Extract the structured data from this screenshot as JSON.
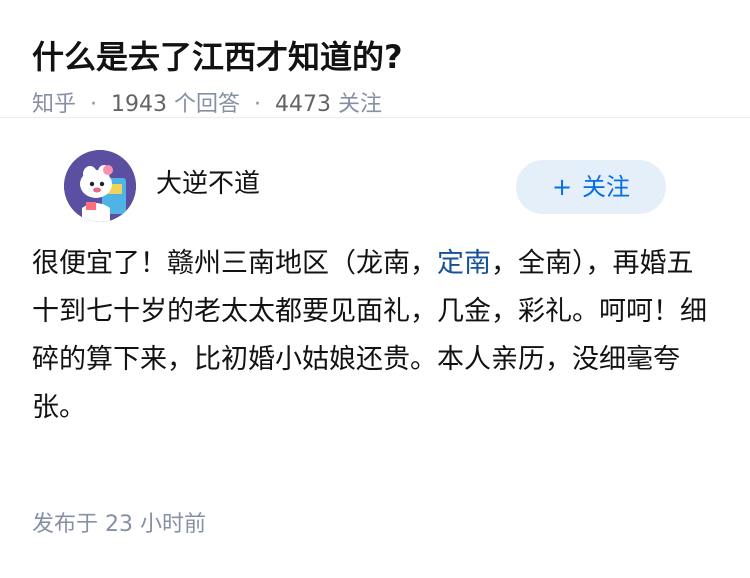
{
  "question": {
    "title": "什么是去了江西才知道的?",
    "source": "知乎",
    "answer_count": "1943",
    "answer_label": "个回答",
    "follower_count": "4473",
    "follower_label": "关注",
    "separator": "·"
  },
  "answer": {
    "author": {
      "name": "大逆不道",
      "avatar_icon": "cartoon-avatar-icon"
    },
    "follow_button": {
      "icon": "plus-icon",
      "plus": "+",
      "label": "关注"
    },
    "content": {
      "part1": "很便宜了！赣州三南地区（龙南，",
      "link": "定南",
      "part2": "，全南），再婚五十到七十岁的老太太都要见面礼，几金，彩礼。呵呵！细碎的算下来，比初婚小姑娘还贵。本人亲历，没细毫夸张。"
    },
    "publish": {
      "prefix": "发布于",
      "num": "23",
      "suffix": "小时前"
    }
  },
  "colors": {
    "accent": "#056de8",
    "link": "#175199",
    "meta": "#8590a6",
    "button_bg": "#e5effa",
    "avatar_bg": "#5a4fa0"
  }
}
